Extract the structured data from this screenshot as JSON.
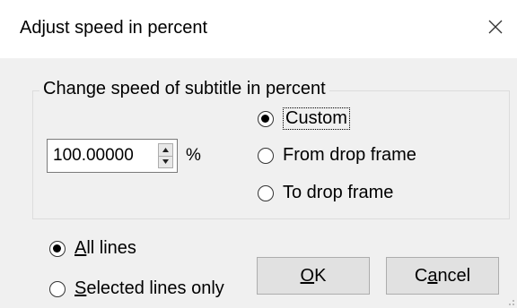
{
  "window": {
    "title": "Adjust speed in percent",
    "close_icon": "close-icon"
  },
  "group": {
    "title": "Change speed of subtitle in percent",
    "speed_value": "100.00000",
    "unit": "%",
    "options": [
      {
        "label_pre": "",
        "label_ul": "",
        "label": "Custom",
        "checked": true
      },
      {
        "label": "From drop frame",
        "checked": false
      },
      {
        "label": "To drop frame",
        "checked": false
      }
    ]
  },
  "scope": {
    "all_lines": {
      "ul": "A",
      "rest": "ll lines",
      "checked": true
    },
    "selected_lines": {
      "ul": "S",
      "rest": "elected lines only",
      "checked": false
    }
  },
  "buttons": {
    "ok": {
      "ul": "O",
      "rest": "K"
    },
    "cancel": {
      "pre": "C",
      "ul": "a",
      "rest": "ncel"
    }
  },
  "colors": {
    "dialog_bg": "#f0f0f0",
    "titlebar_bg": "#ffffff",
    "button_bg": "#e1e1e1",
    "button_border": "#adadad"
  }
}
